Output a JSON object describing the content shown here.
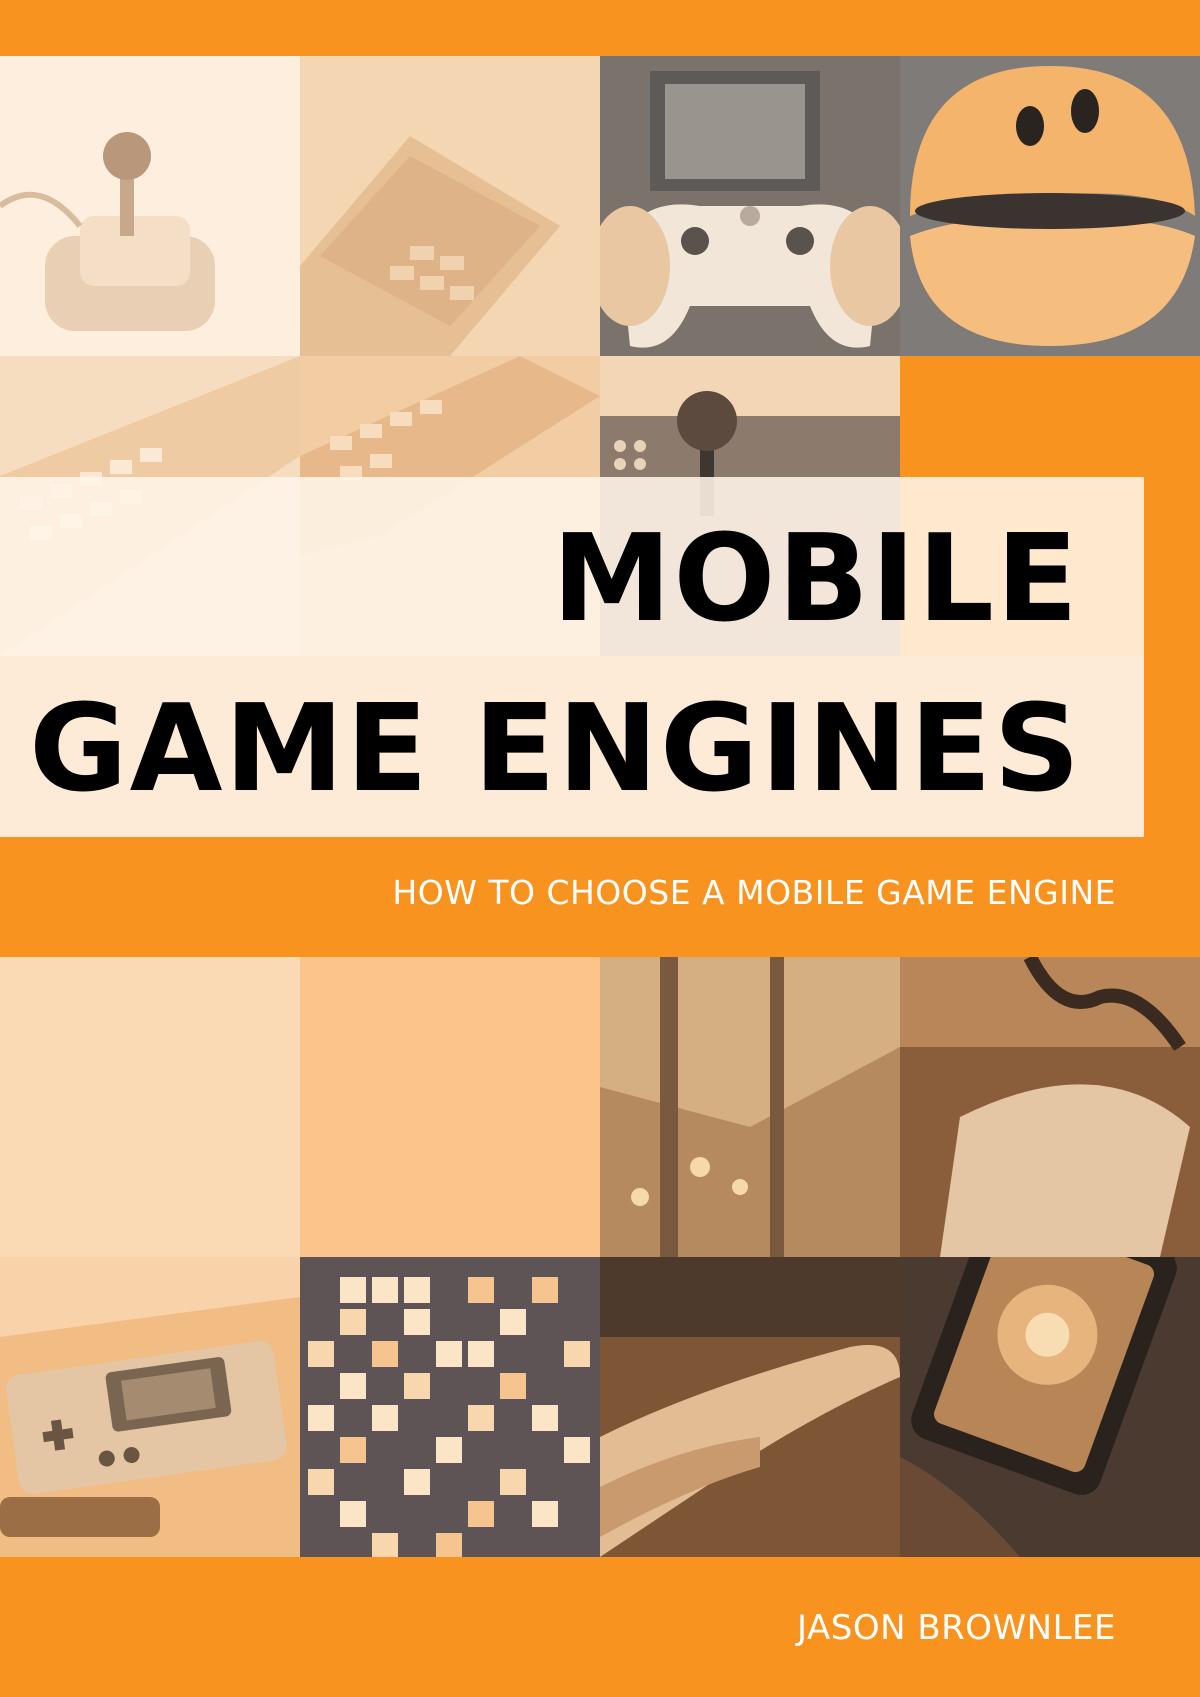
{
  "cover": {
    "title_line_1": "MOBILE",
    "title_line_2": "GAME ENGINES",
    "subtitle": "HOW TO CHOOSE A MOBILE GAME ENGINE",
    "author": "JASON BROWNLEE"
  },
  "colors": {
    "accent": "#F7931E",
    "band_light": "#FDEBD8",
    "title_text": "#000000",
    "subtitle_text": "#FFFFFF"
  },
  "photos": [
    {
      "icon": "joystick-icon"
    },
    {
      "icon": "retro-computer-icon"
    },
    {
      "icon": "gamepad-icon"
    },
    {
      "icon": "pacman-icon"
    },
    {
      "icon": "keyboard-icon"
    },
    {
      "icon": "arcade-stick-icon"
    },
    {
      "icon": "handheld-console-icon"
    },
    {
      "icon": "pixel-grid-icon"
    },
    {
      "icon": "smartphone-game-icon"
    }
  ]
}
